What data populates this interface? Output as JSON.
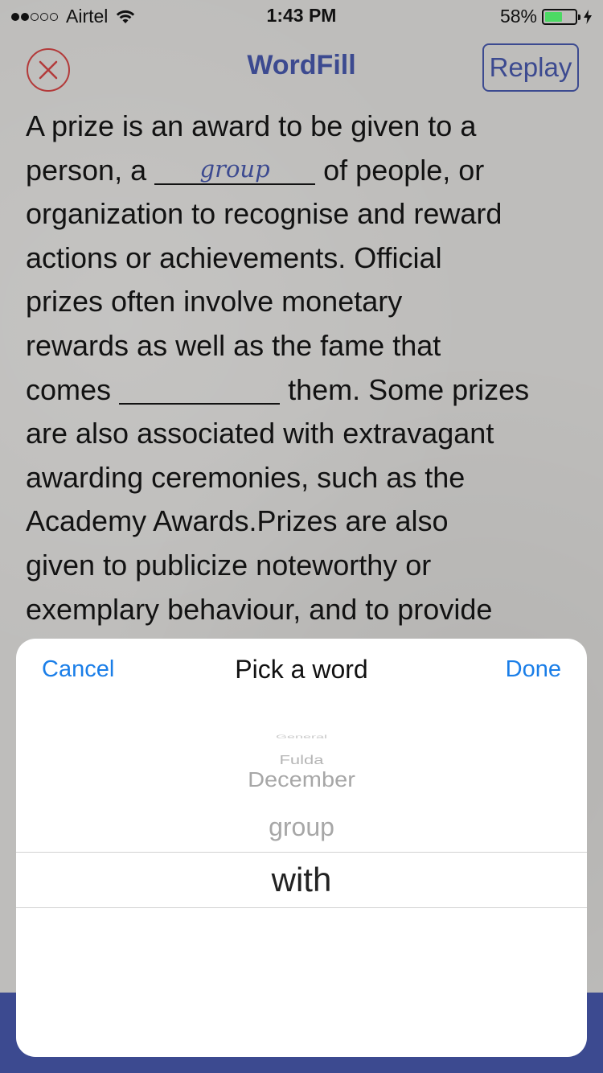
{
  "status_bar": {
    "carrier": "Airtel",
    "time": "1:43 PM",
    "battery_percent": "58%",
    "battery_level": 0.58,
    "signal_bars_filled": 2,
    "signal_bars_total": 5,
    "wifi_icon": "wifi-icon",
    "charging_icon": "bolt-icon"
  },
  "nav": {
    "title": "WordFill",
    "close_icon": "close-icon",
    "replay_label": "Replay"
  },
  "passage": {
    "lines": [
      " A prize is an award to be given to a",
      "person, a",
      "of people, or",
      "organization to recognise and reward",
      "actions or achievements. Official",
      "prizes often involve monetary",
      "rewards as well as the fame that",
      "comes",
      "them. Some prizes",
      "are also associated with extravagant",
      "awarding ceremonies, such as the",
      "Academy Awards.Prizes are also",
      "given to publicize noteworthy or",
      "exemplary behaviour, and to provide"
    ],
    "blank_1_word": "group",
    "blank_2_word": ""
  },
  "picker": {
    "cancel_label": "Cancel",
    "title": "Pick a word",
    "done_label": "Done",
    "options_above": [
      "General",
      "Fulda",
      "December",
      "group"
    ],
    "selected": "with"
  },
  "colors": {
    "accent": "#3c4a90",
    "ios_blue": "#1a7ee8",
    "close_red": "#b33a3a",
    "battery_green": "#4cd964",
    "blank_word": "#3c4a90"
  }
}
